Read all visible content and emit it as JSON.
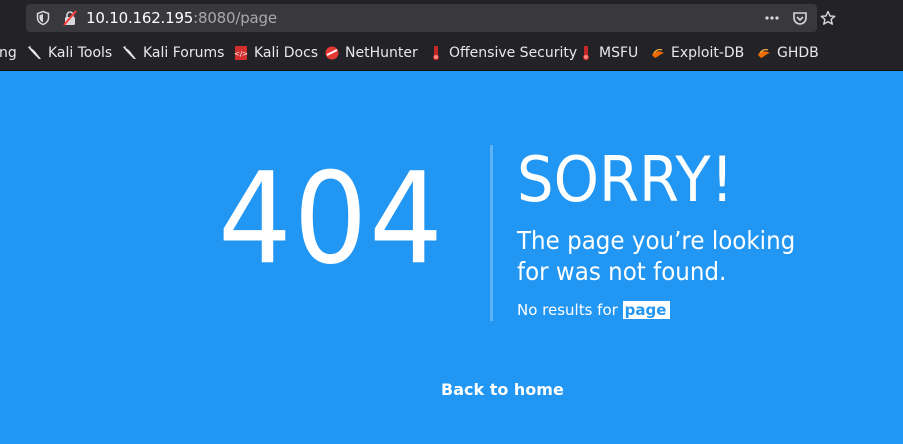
{
  "browser": {
    "url_host": "10.10.162.195",
    "url_rest": ":8080/page",
    "bookmarks": [
      {
        "label": "ng",
        "icon": "none"
      },
      {
        "label": "Kali Tools",
        "icon": "kali-dragon-icon"
      },
      {
        "label": "Kali Forums",
        "icon": "kali-dragon-icon"
      },
      {
        "label": "Kali Docs",
        "icon": "kali-docs-icon"
      },
      {
        "label": "NetHunter",
        "icon": "nethunter-icon"
      },
      {
        "label": "Offensive Security",
        "icon": "offsec-icon"
      },
      {
        "label": "MSFU",
        "icon": "offsec-icon"
      },
      {
        "label": "Exploit-DB",
        "icon": "exploitdb-icon"
      },
      {
        "label": "GHDB",
        "icon": "exploitdb-icon"
      }
    ]
  },
  "page": {
    "code": "404",
    "heading": "SORRY!",
    "message": "The page you’re looking for was not found.",
    "no_results_prefix": "No results for",
    "search_term": "page",
    "back_link": "Back to home"
  },
  "colors": {
    "background": "#2196f3",
    "chrome": "#232327",
    "urlbar": "#38383d"
  }
}
